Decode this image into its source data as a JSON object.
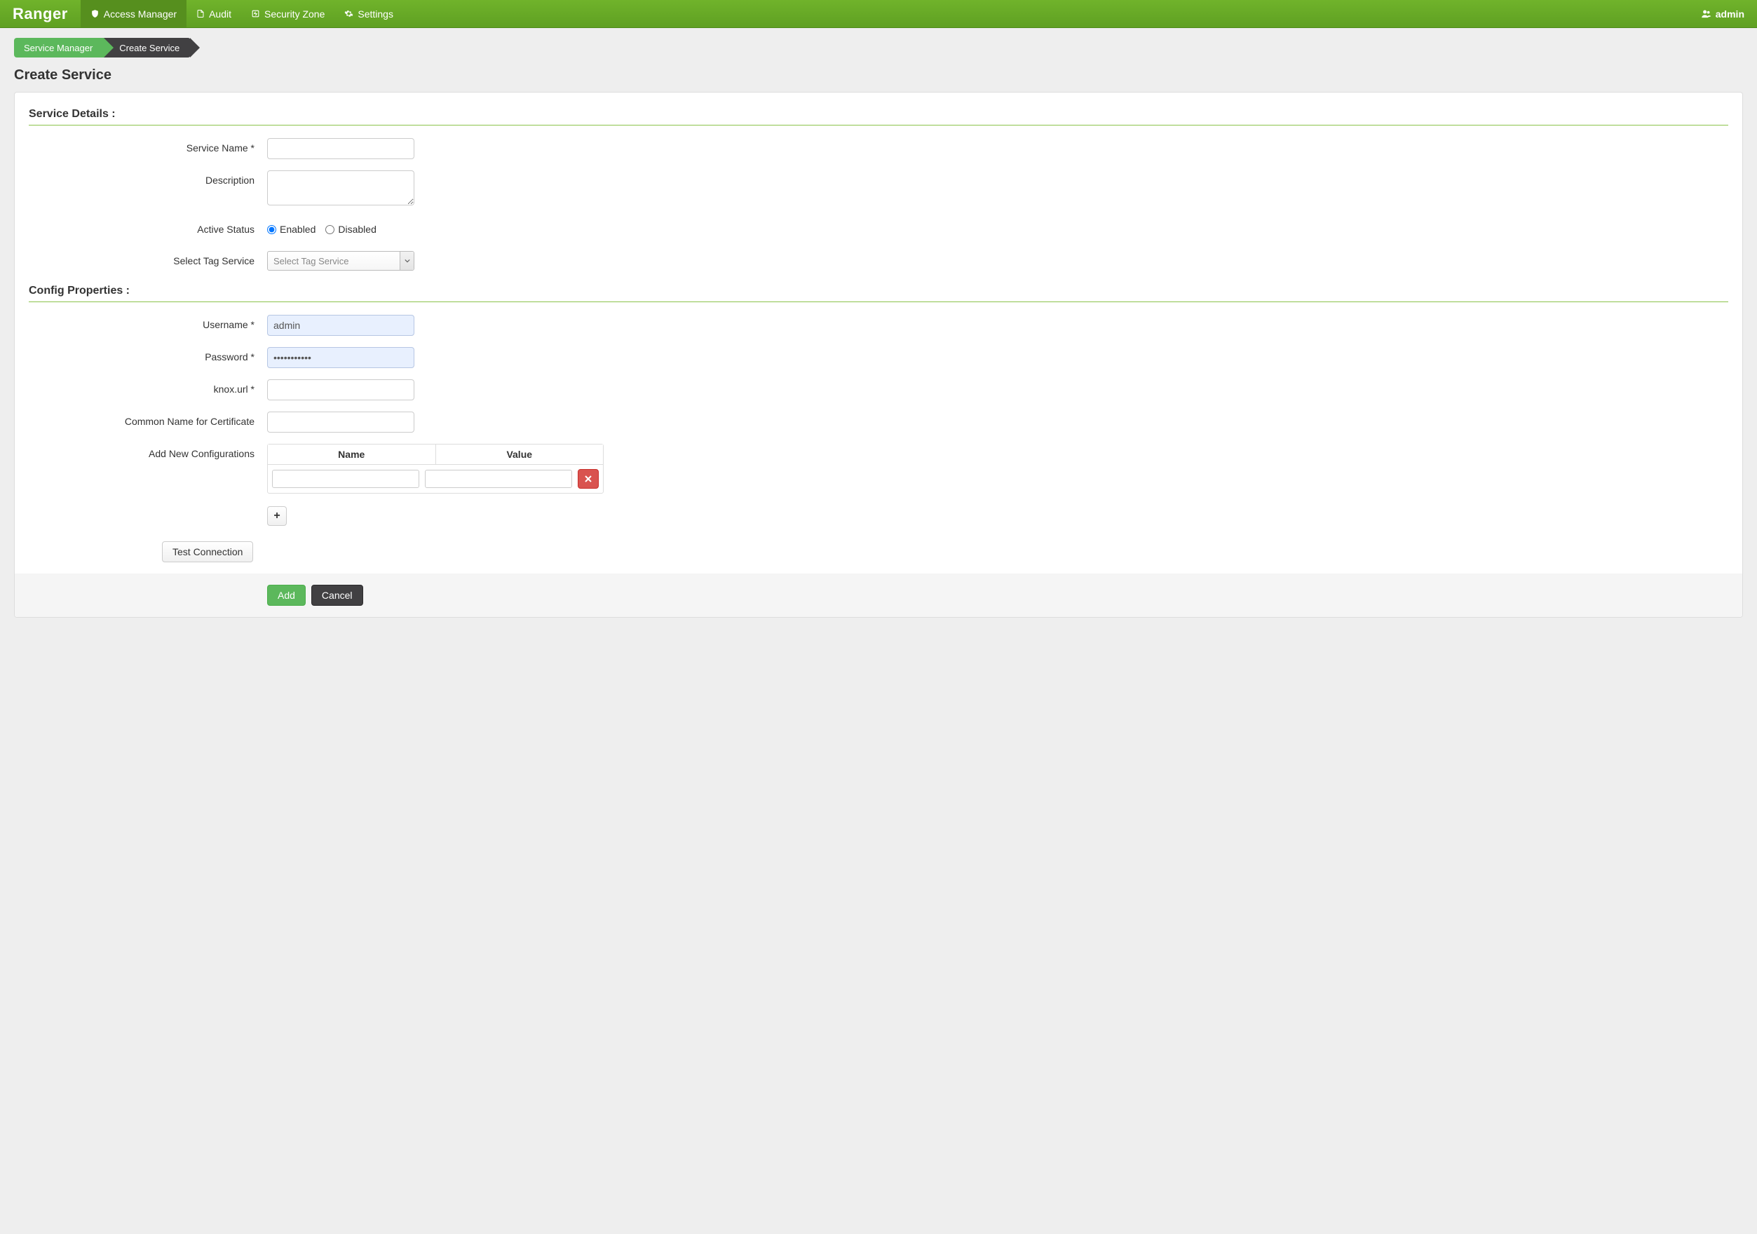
{
  "brand": "Ranger",
  "nav": {
    "access_manager": "Access Manager",
    "audit": "Audit",
    "security_zone": "Security Zone",
    "settings": "Settings"
  },
  "user": {
    "name": "admin"
  },
  "breadcrumb": {
    "item1": "Service Manager",
    "item2": "Create Service"
  },
  "page_title": "Create Service",
  "sections": {
    "details_title": "Service Details :",
    "config_title": "Config Properties :"
  },
  "labels": {
    "service_name": "Service Name *",
    "description": "Description",
    "active_status": "Active Status",
    "select_tag": "Select Tag Service",
    "username": "Username *",
    "password": "Password *",
    "knox_url": "knox.url *",
    "common_name": "Common Name for Certificate",
    "add_new_cfg": "Add New Configurations",
    "cfg_name_col": "Name",
    "cfg_value_col": "Value",
    "enabled": "Enabled",
    "disabled": "Disabled"
  },
  "values": {
    "service_name": "",
    "description": "",
    "active_status": "enabled",
    "select_tag_placeholder": "Select Tag Service",
    "username": "admin",
    "password": "•••••••••••",
    "knox_url": "",
    "common_name": "",
    "cfg_rows": [
      {
        "name": "",
        "value": ""
      }
    ]
  },
  "buttons": {
    "test_connection": "Test Connection",
    "add": "Add",
    "cancel": "Cancel",
    "plus": "+",
    "remove": "✕"
  }
}
